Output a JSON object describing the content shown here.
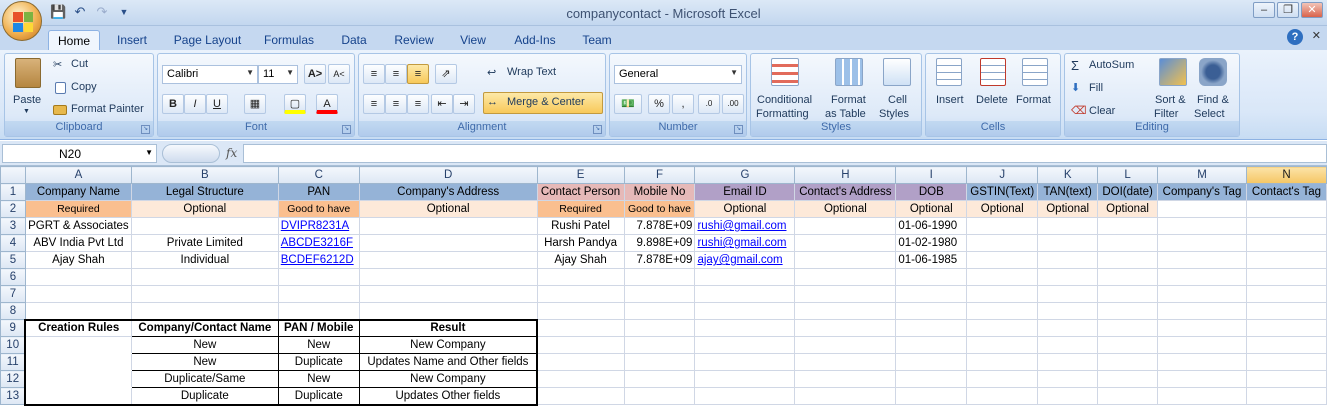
{
  "window": {
    "title": "companycontact - Microsoft Excel",
    "controls": [
      "minimize",
      "restore",
      "close"
    ]
  },
  "ribbon_tabs": [
    "Home",
    "Insert",
    "Page Layout",
    "Formulas",
    "Data",
    "Review",
    "View",
    "Add-Ins",
    "Team"
  ],
  "active_tab": "Home",
  "clipboard": {
    "paste": "Paste",
    "cut": "Cut",
    "copy": "Copy",
    "format_painter": "Format Painter",
    "label": "Clipboard"
  },
  "font": {
    "family": "Calibri",
    "size": "11",
    "label": "Font"
  },
  "alignment": {
    "wrap_text": "Wrap Text",
    "merge_center": "Merge & Center",
    "label": "Alignment"
  },
  "number": {
    "format": "General",
    "label": "Number"
  },
  "styles": {
    "conditional": "Conditional",
    "conditional2": "Formatting",
    "format_as": "Format",
    "format_as2": "as Table",
    "cell": "Cell",
    "cell2": "Styles",
    "label": "Styles"
  },
  "cells": {
    "insert": "Insert",
    "delete": "Delete",
    "format": "Format",
    "label": "Cells"
  },
  "editing": {
    "autosum": "AutoSum",
    "fill": "Fill",
    "clear": "Clear",
    "sort": "Sort &",
    "sort2": "Filter",
    "find": "Find &",
    "find2": "Select",
    "label": "Editing"
  },
  "formula_bar": {
    "name_box": "N20",
    "fx": "fx",
    "value": ""
  },
  "columns": [
    "A",
    "B",
    "C",
    "D",
    "E",
    "F",
    "G",
    "H",
    "I",
    "J",
    "K",
    "L",
    "M",
    "N"
  ],
  "selected_column": "N",
  "rows": {
    "r1": [
      "Company Name",
      "Legal Structure",
      "PAN",
      "Company's Address",
      "Contact Person",
      "Mobile No",
      "Email ID",
      "Contact's Address",
      "DOB",
      "GSTIN(Text)",
      "TAN(text)",
      "DOI(date)",
      "Company's Tag",
      "Contact's Tag"
    ],
    "r2": [
      "Required",
      "Optional",
      "Good to have",
      "Optional",
      "Required",
      "Good to have",
      "Optional",
      "Optional",
      "Optional",
      "Optional",
      "Optional",
      "Optional"
    ],
    "r3": [
      "PGRT & Associates",
      "",
      "DVIPR8231A",
      "",
      "Rushi Patel",
      "7.878E+09",
      "rushi@gmail.com",
      "",
      "01-06-1990"
    ],
    "r4": [
      "ABV India Pvt Ltd",
      "Private Limited",
      "ABCDE3216F",
      "",
      "Harsh Pandya",
      "9.898E+09",
      "rushi@gmail.com",
      "",
      "01-02-1980"
    ],
    "r5": [
      "Ajay Shah",
      "Individual",
      "BCDEF6212D",
      "",
      "Ajay Shah",
      "7.878E+09",
      "ajay@gmail.com",
      "",
      "01-06-1985"
    ]
  },
  "rules": {
    "title": "Creation Rules",
    "headers": [
      "Company/Contact Name",
      "PAN / Mobile",
      "Result"
    ],
    "rows": [
      [
        "New",
        "New",
        "New Company"
      ],
      [
        "New",
        "Duplicate",
        "Updates Name and Other fields"
      ],
      [
        "Duplicate/Same",
        "New",
        "New Company"
      ],
      [
        "Duplicate",
        "Duplicate",
        "Updates Other fields"
      ]
    ]
  },
  "row_numbers": [
    "1",
    "2",
    "3",
    "4",
    "5",
    "6",
    "7",
    "8",
    "9",
    "10",
    "11",
    "12",
    "13"
  ]
}
